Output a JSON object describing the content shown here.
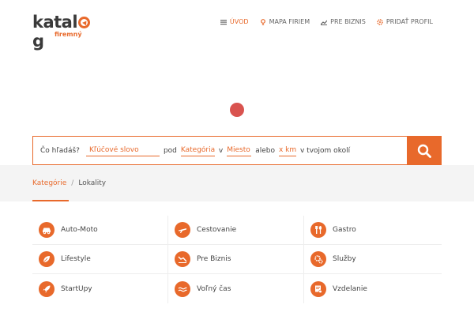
{
  "brand": {
    "logo_main": "katalog",
    "logo_sub": "firemný",
    "accent": "#e8692b"
  },
  "nav": [
    {
      "label": "ÚVOD",
      "icon": "list-icon",
      "active": true
    },
    {
      "label": "MAPA FIRIEM",
      "icon": "map-pin-icon",
      "active": false
    },
    {
      "label": "PRE BIZNIS",
      "icon": "chart-icon",
      "active": false
    },
    {
      "label": "PRIDAŤ PROFIL",
      "icon": "gear-plus-icon",
      "active": false
    }
  ],
  "search": {
    "prefix": "Čo hľadáš?",
    "keyword_placeholder": "Kľúčové slovo",
    "word_pod": "pod",
    "category_value": "Kategória",
    "word_v": "v",
    "place_value": "Miesto",
    "word_alebo": "alebo",
    "km_value": "x km",
    "suffix": "v tvojom okolí",
    "button_icon": "search-icon"
  },
  "breadcrumb": {
    "active": "Kategórie",
    "separator": "/",
    "other": "Lokality"
  },
  "categories": [
    [
      {
        "label": "Auto-Moto",
        "icon": "car-icon"
      },
      {
        "label": "Cestovanie",
        "icon": "plane-icon"
      },
      {
        "label": "Gastro",
        "icon": "cutlery-icon"
      }
    ],
    [
      {
        "label": "Lifestyle",
        "icon": "leaf-icon"
      },
      {
        "label": "Pre Biznis",
        "icon": "chart-icon"
      },
      {
        "label": "Služby",
        "icon": "gears-icon"
      }
    ],
    [
      {
        "label": "StartUpy",
        "icon": "rocket-icon"
      },
      {
        "label": "Voľný čas",
        "icon": "waves-icon"
      },
      {
        "label": "Vzdelanie",
        "icon": "certificate-icon"
      }
    ]
  ]
}
